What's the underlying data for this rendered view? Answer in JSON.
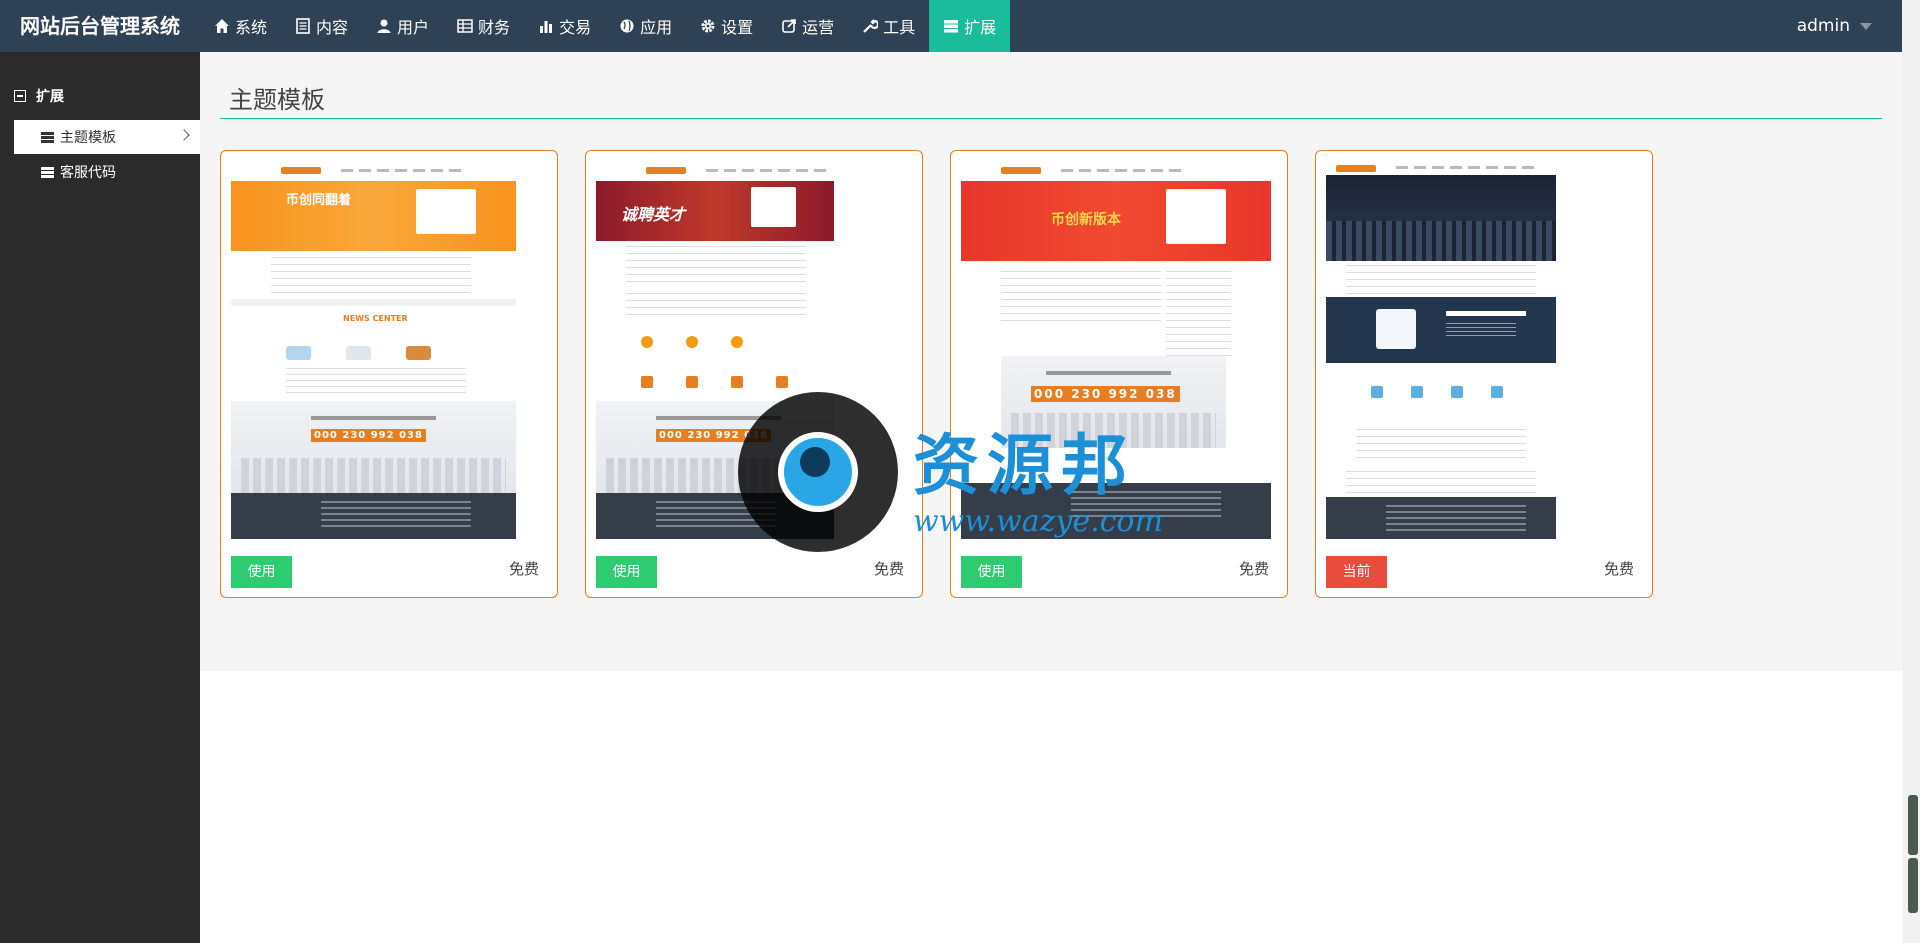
{
  "brand": "网站后台管理系统",
  "nav": [
    {
      "label": "系统",
      "icon": "home-icon"
    },
    {
      "label": "内容",
      "icon": "document-icon"
    },
    {
      "label": "用户",
      "icon": "user-icon"
    },
    {
      "label": "财务",
      "icon": "table-icon"
    },
    {
      "label": "交易",
      "icon": "bar-chart-icon"
    },
    {
      "label": "应用",
      "icon": "globe-icon"
    },
    {
      "label": "设置",
      "icon": "gear-icon"
    },
    {
      "label": "运营",
      "icon": "share-icon"
    },
    {
      "label": "工具",
      "icon": "wrench-icon"
    },
    {
      "label": "扩展",
      "icon": "server-icon"
    }
  ],
  "active_nav": "扩展",
  "user": "admin",
  "sidebar": {
    "section": "扩展",
    "items": [
      {
        "label": "主题模板"
      },
      {
        "label": "客服代码"
      }
    ]
  },
  "page_title": "主题模板",
  "themes": [
    {
      "button": "使用",
      "price": "免费",
      "digits": "000 230 992 038",
      "news_title": "NEWS CENTER",
      "banner_text": "币创同翻着"
    },
    {
      "button": "使用",
      "price": "免费",
      "digits": "000 230 992 038",
      "banner_text": "诚聘英才"
    },
    {
      "button": "使用",
      "price": "免费",
      "digits": "000 230 992 038",
      "banner_text": "币创新版本"
    },
    {
      "button": "当前",
      "price": "免费"
    }
  ],
  "watermark": {
    "text": "资源邦",
    "url": "www.wazye.com"
  },
  "colors": {
    "nav_bg": "#2f4154",
    "active": "#1abc9c",
    "card_border": "#e67e22",
    "use_btn": "#2ecc71",
    "current_btn": "#e74c3c"
  }
}
